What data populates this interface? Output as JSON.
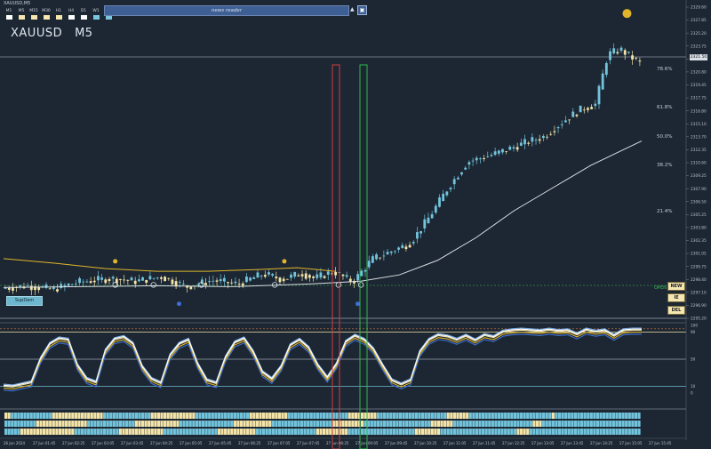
{
  "window_title": "XAUUSD,M5",
  "symbol": {
    "name": "XAUUSD",
    "timeframe": "M5"
  },
  "timeframe_buttons": [
    {
      "label": "M1",
      "color": "#ffffff"
    },
    {
      "label": "M5",
      "color": "#f6e7b0"
    },
    {
      "label": "M15",
      "color": "#f6e7b0"
    },
    {
      "label": "M30",
      "color": "#f6e7b0"
    },
    {
      "label": "H1",
      "color": "#f6e7b0"
    },
    {
      "label": "H4",
      "color": "#ffffff"
    },
    {
      "label": "D1",
      "color": "#ffffff"
    },
    {
      "label": "W1",
      "color": "#78c7df"
    },
    {
      "label": "MN",
      "color": "#78c7df"
    }
  ],
  "news_reader": {
    "label": "news reader"
  },
  "supdem_button": "SupDem",
  "order_buttons": {
    "new": "NEW",
    "ie": "IE",
    "del": "DEL"
  },
  "open_label": "OPEN",
  "current_price": "2321.50",
  "fib_levels": [
    {
      "label": "78.6%",
      "price": 2322.4
    },
    {
      "label": "61.8%",
      "price": 2318.2
    },
    {
      "label": "50.0%",
      "price": 2315.0
    },
    {
      "label": "38.2%",
      "price": 2311.8
    },
    {
      "label": "21.4%",
      "price": 2306.7
    }
  ],
  "colors": {
    "background": "#1d2733",
    "bull": "#72c4dc",
    "bear": "#f4e4a8",
    "slow_ma": "#d9dde2",
    "gold_ma": "#e0b52a",
    "red_box": "#d23c3c",
    "green_box": "#2fb84a"
  },
  "chart_data": {
    "type": "candlestick",
    "symbol": "XAUUSD",
    "timeframe": "M5",
    "y_ticks": [
      "2329.60",
      "2327.85",
      "2325.20",
      "2323.75",
      "2321.50",
      "2320.80",
      "2319.45",
      "2317.75",
      "2316.80",
      "2315.10",
      "2313.70",
      "2312.35",
      "2310.60",
      "2309.25",
      "2307.90",
      "2306.50",
      "2305.25",
      "2303.80",
      "2302.35",
      "2301.05",
      "2299.75",
      "2298.40",
      "2297.10",
      "2296.90",
      "2295.20"
    ],
    "x_ticks": [
      "26 Jun 2024",
      "27 Jun 01:45",
      "27 Jun 02:25",
      "27 Jun 03:05",
      "27 Jun 03:45",
      "27 Jun 04:25",
      "27 Jun 05:05",
      "27 Jun 05:45",
      "27 Jun 06:25",
      "27 Jun 07:05",
      "27 Jun 07:45",
      "27 Jun 08:25",
      "27 Jun 09:05",
      "27 Jun 09:45",
      "27 Jun 10:25",
      "27 Jun 11:05",
      "27 Jun 11:45",
      "27 Jun 12:25",
      "27 Jun 13:05",
      "27 Jun 13:45",
      "27 Jun 14:25",
      "27 Jun 15:05",
      "27 Jun 15:45"
    ],
    "ylim": [
      2295.2,
      2329.6
    ],
    "price_path": [
      [
        0,
        2298.3
      ],
      [
        0.04,
        2298.6
      ],
      [
        0.08,
        2298.2
      ],
      [
        0.12,
        2299.0
      ],
      [
        0.17,
        2299.4
      ],
      [
        0.21,
        2299.1
      ],
      [
        0.25,
        2299.6
      ],
      [
        0.29,
        2298.5
      ],
      [
        0.33,
        2299.2
      ],
      [
        0.37,
        2298.8
      ],
      [
        0.41,
        2299.9
      ],
      [
        0.44,
        2299.3
      ],
      [
        0.47,
        2300.0
      ],
      [
        0.49,
        2299.4
      ],
      [
        0.52,
        2300.2
      ],
      [
        0.55,
        2299.0
      ],
      [
        0.58,
        2301.5
      ],
      [
        0.61,
        2302.4
      ],
      [
        0.64,
        2303.3
      ],
      [
        0.67,
        2306.2
      ],
      [
        0.7,
        2309.5
      ],
      [
        0.73,
        2312.3
      ],
      [
        0.76,
        2312.9
      ],
      [
        0.79,
        2313.6
      ],
      [
        0.82,
        2314.4
      ],
      [
        0.85,
        2315.1
      ],
      [
        0.88,
        2316.8
      ],
      [
        0.91,
        2318.2
      ],
      [
        0.93,
        2318.6
      ],
      [
        0.95,
        2324.2
      ],
      [
        0.97,
        2324.7
      ],
      [
        1.0,
        2323.2
      ]
    ],
    "slow_ma_path": [
      [
        0,
        2298.4
      ],
      [
        0.12,
        2298.5
      ],
      [
        0.24,
        2298.6
      ],
      [
        0.36,
        2298.5
      ],
      [
        0.48,
        2298.8
      ],
      [
        0.56,
        2299.1
      ],
      [
        0.62,
        2299.8
      ],
      [
        0.68,
        2301.4
      ],
      [
        0.74,
        2303.9
      ],
      [
        0.8,
        2306.9
      ],
      [
        0.86,
        2309.4
      ],
      [
        0.92,
        2311.9
      ],
      [
        0.97,
        2313.6
      ],
      [
        1.0,
        2314.6
      ]
    ],
    "gold_ma_path": [
      [
        0,
        2301.6
      ],
      [
        0.08,
        2301.1
      ],
      [
        0.16,
        2300.5
      ],
      [
        0.24,
        2300.2
      ],
      [
        0.32,
        2300.2
      ],
      [
        0.4,
        2300.4
      ],
      [
        0.46,
        2300.6
      ],
      [
        0.52,
        2300.2
      ]
    ],
    "oscillator_ylim": [
      0,
      100
    ],
    "oscillator_levels": [
      90,
      50,
      10
    ],
    "oscillator_series": [
      {
        "values": [
          10,
          9,
          12,
          15,
          50,
          72,
          80,
          78,
          40,
          20,
          15,
          62,
          79,
          82,
          72,
          38,
          20,
          14,
          55,
          72,
          78,
          42,
          18,
          14,
          52,
          74,
          80,
          60,
          30,
          20,
          38,
          70,
          78,
          66,
          40,
          22,
          42,
          75,
          84,
          78,
          64,
          40,
          18,
          12,
          18,
          60,
          78,
          85,
          83,
          78,
          84,
          77,
          85,
          82,
          90,
          92,
          93,
          92,
          91,
          93,
          91,
          92,
          86,
          93,
          90,
          92,
          84,
          92,
          93,
          93
        ]
      }
    ],
    "histogram_rows": 3
  }
}
